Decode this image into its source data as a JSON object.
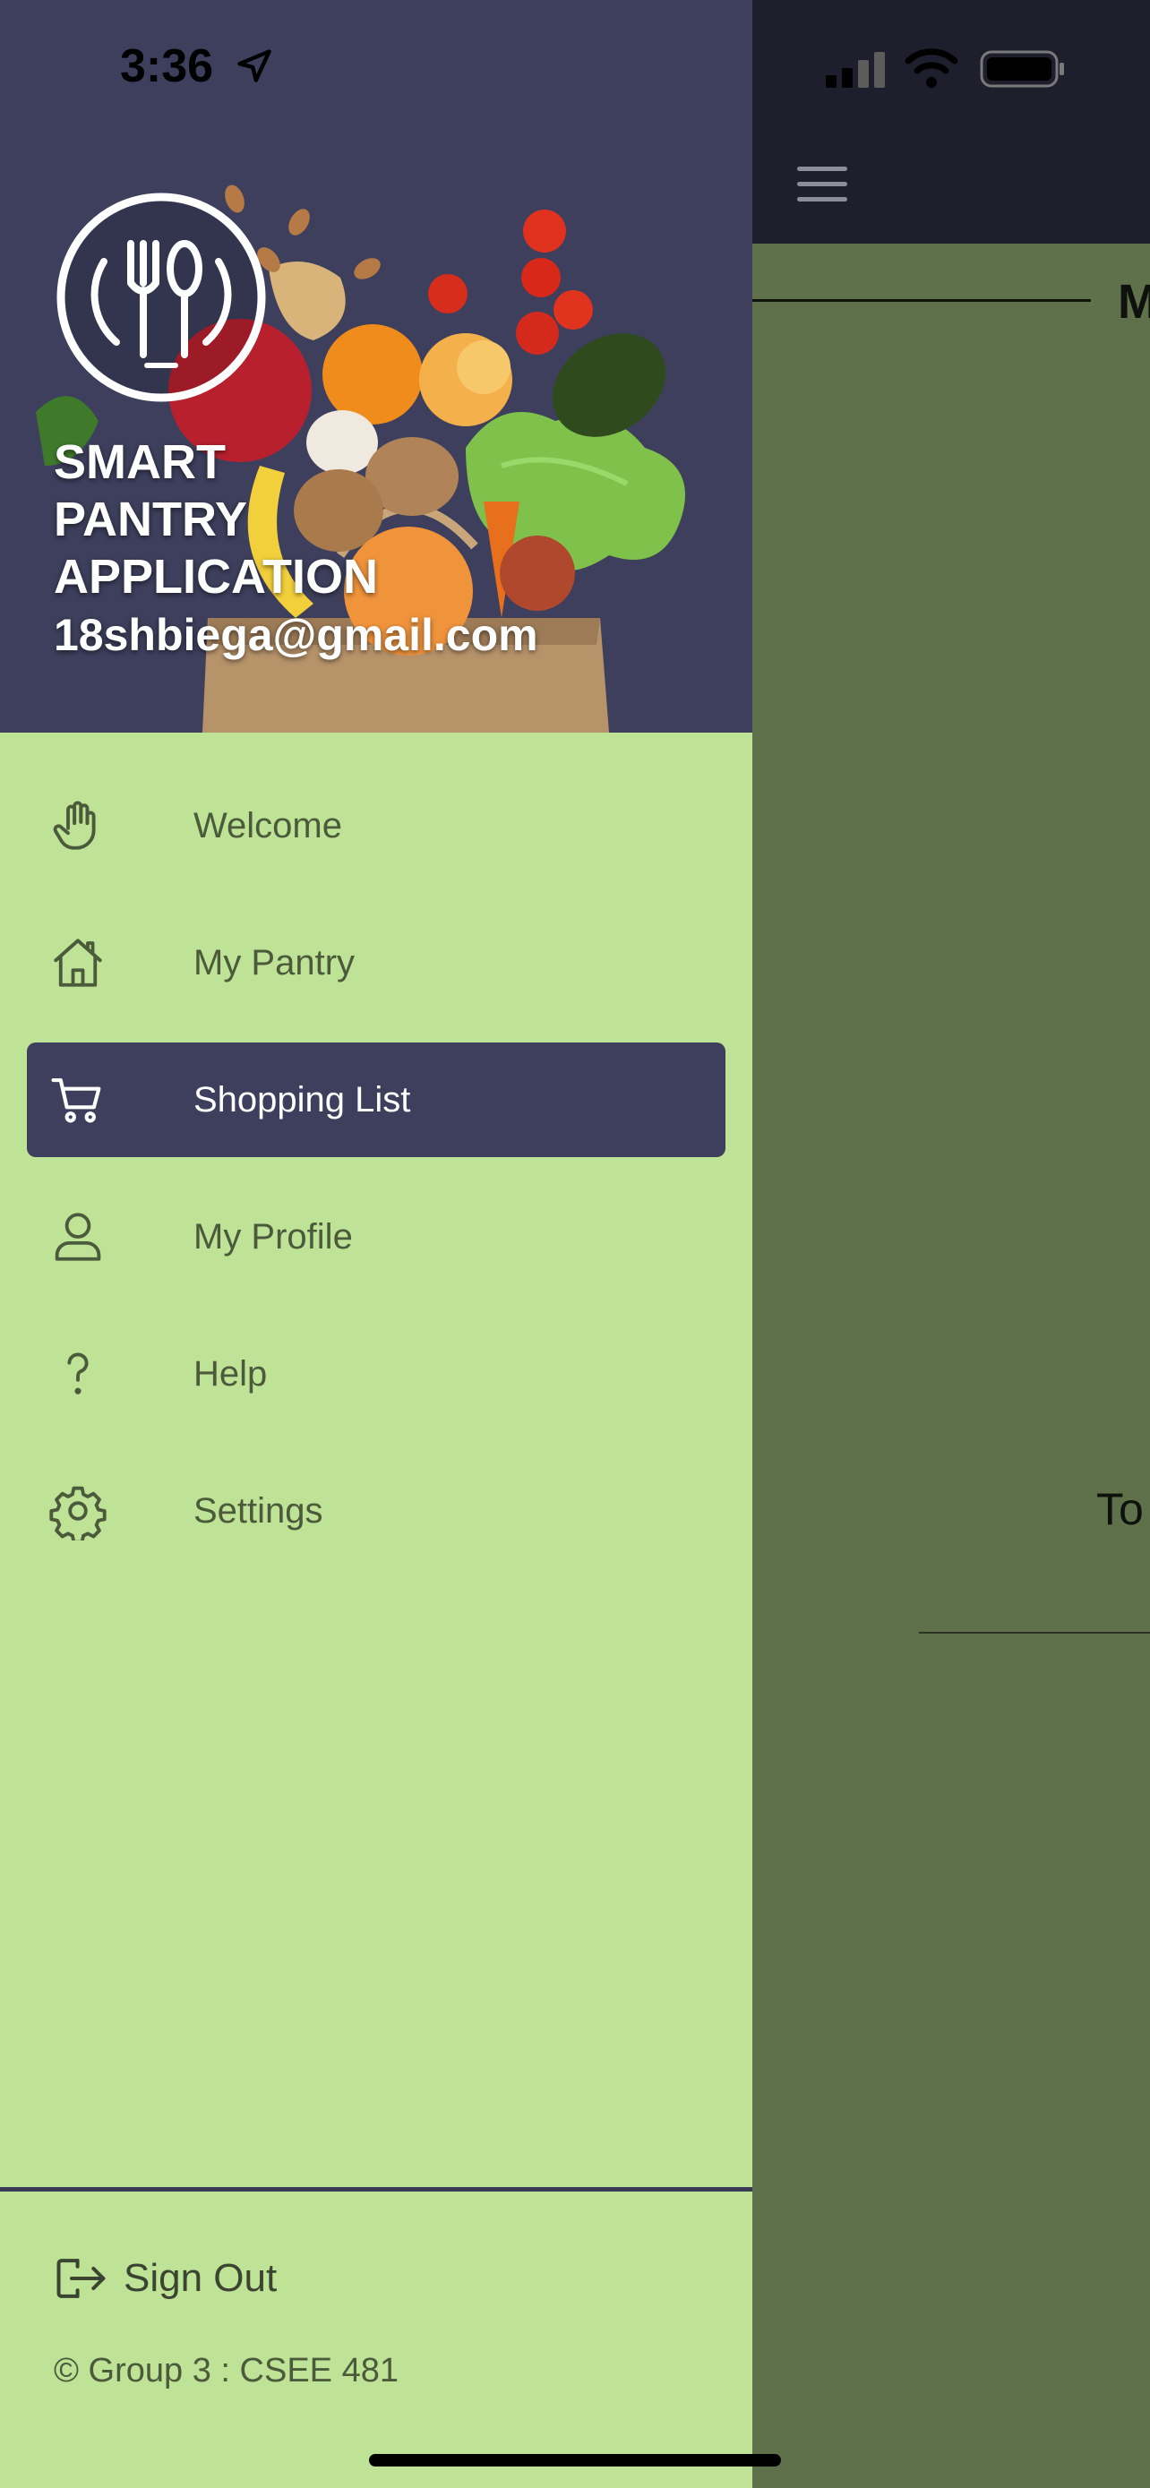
{
  "status_bar": {
    "time": "3:36"
  },
  "drawer": {
    "header": {
      "title_line1": "SMART",
      "title_line2": "PANTRY",
      "title_line3": "APPLICATION",
      "email": "18shbiega@gmail.com"
    },
    "items": [
      {
        "label": "Welcome",
        "icon": "hand-icon",
        "active": false
      },
      {
        "label": "My Pantry",
        "icon": "home-icon",
        "active": false
      },
      {
        "label": "Shopping List",
        "icon": "cart-icon",
        "active": true
      },
      {
        "label": "My Profile",
        "icon": "user-icon",
        "active": false
      },
      {
        "label": "Help",
        "icon": "question-icon",
        "active": false
      },
      {
        "label": "Settings",
        "icon": "gear-icon",
        "active": false
      }
    ],
    "sign_out": {
      "label": "Sign Out",
      "icon": "sign-out-icon"
    },
    "copyright": "© Group 3 : CSEE 481"
  },
  "behind_screen": {
    "heading_fragment": "M",
    "text_fragment": "To"
  },
  "colors": {
    "drawer_bg": "#bee296",
    "header_bg": "#3d3f5c",
    "active_item_bg": "#3d3f5c",
    "screen_bg": "#5e714b",
    "topbar_bg": "#1f1e2c",
    "nav_text": "#4c5a3c"
  }
}
